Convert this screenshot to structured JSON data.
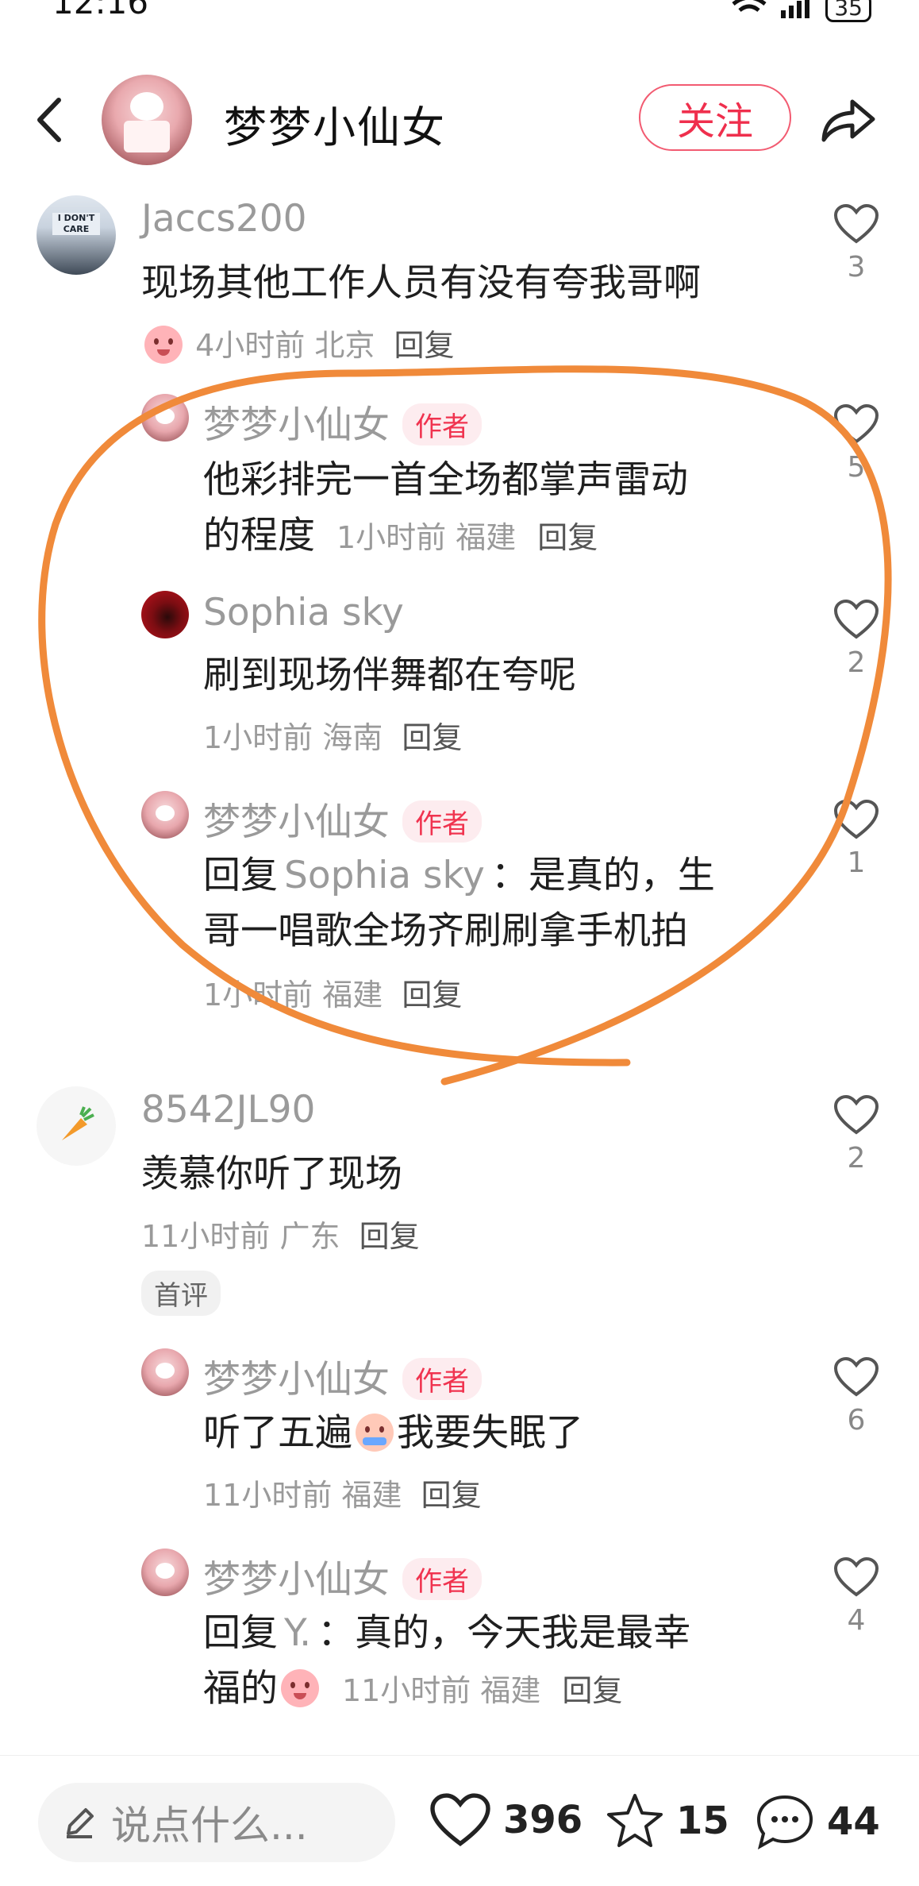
{
  "status": {
    "time": "12:16",
    "battery": "35"
  },
  "header": {
    "title": "梦梦小仙女",
    "follow_label": "关注"
  },
  "comments": [
    {
      "user": "Jaccs200",
      "text": "现场其他工作人员有没有夸我哥啊",
      "time": "4小时前",
      "location": "北京",
      "reply_label": "回复",
      "likes": "3",
      "avatar_text": "I DON'T CARE"
    },
    {
      "user": "梦梦小仙女",
      "tag": "作者",
      "text_line1": "他彩排完一首全场都掌声雷动",
      "text_line2": "的程度",
      "time": "1小时前",
      "location": "福建",
      "reply_label": "回复",
      "likes": "5"
    },
    {
      "user": "Sophia sky",
      "text": "刷到现场伴舞都在夸呢",
      "time": "1小时前",
      "location": "海南",
      "reply_label": "回复",
      "likes": "2"
    },
    {
      "user": "梦梦小仙女",
      "tag": "作者",
      "reply_prefix": "回复",
      "reply_to": "Sophia sky",
      "text_line1": "：是真的，生",
      "text_line2": "哥一唱歌全场齐刷刷拿手机拍",
      "time": "1小时前",
      "location": "福建",
      "reply_label": "回复",
      "likes": "1"
    },
    {
      "user": "8542JL90",
      "text": "羡慕你听了现场",
      "time": "11小时前",
      "location": "广东",
      "reply_label": "回复",
      "likes": "2",
      "badge": "首评"
    },
    {
      "user": "梦梦小仙女",
      "tag": "作者",
      "text_before": "听了五遍",
      "text_after": "我要失眠了",
      "time": "11小时前",
      "location": "福建",
      "reply_label": "回复",
      "likes": "6"
    },
    {
      "user": "梦梦小仙女",
      "tag": "作者",
      "reply_prefix": "回复",
      "reply_to": "Y.",
      "text_line1": "：真的，今天我是最幸",
      "text_line2": "福的",
      "time": "11小时前",
      "location": "福建",
      "reply_label": "回复",
      "likes": "4"
    }
  ],
  "bottom_bar": {
    "input_placeholder": "说点什么...",
    "likes": "396",
    "stars": "15",
    "comments": "44"
  },
  "colors": {
    "accent": "#ef2f4d",
    "annotation": "#f08a3a"
  },
  "icons": [
    "back-arrow-icon",
    "share-icon",
    "heart-icon",
    "star-icon",
    "comment-icon",
    "pencil-icon",
    "carrot-icon"
  ]
}
